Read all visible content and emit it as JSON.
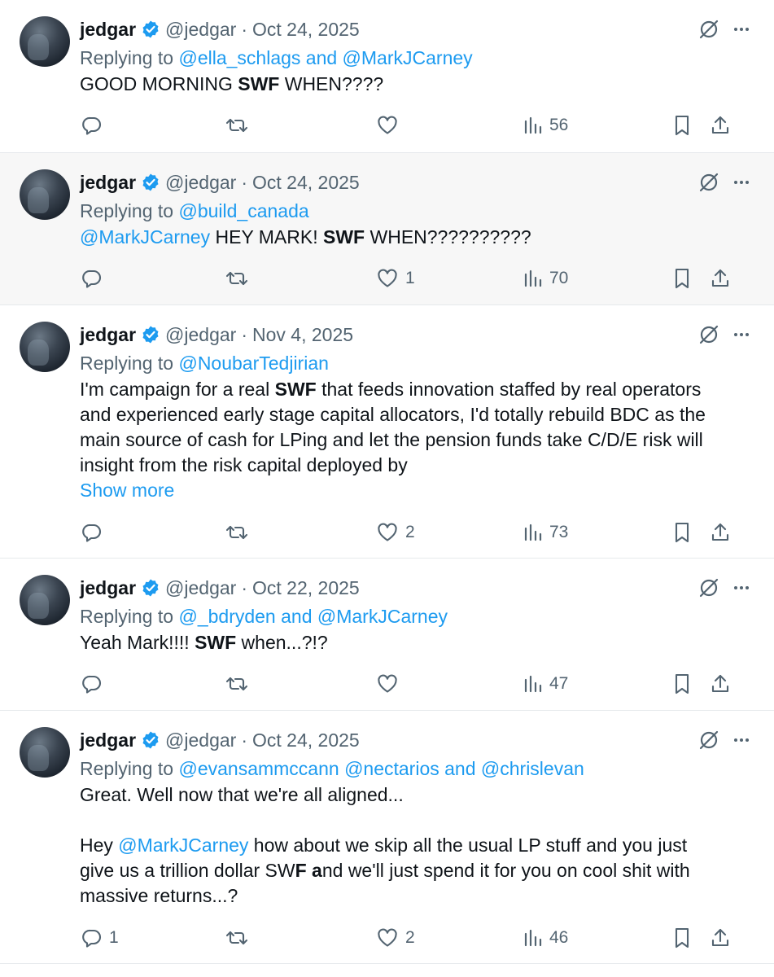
{
  "tweets": [
    {
      "name": "jedgar",
      "handle": "@jedgar",
      "dot": "·",
      "date": "Oct 24, 2025",
      "replying_prefix": "Replying to ",
      "replying_to": "@ella_schlags and @MarkJCarney",
      "body": [
        {
          "parts": [
            {
              "t": "GOOD MORNING "
            },
            {
              "t": "SWF",
              "b": true
            },
            {
              "t": " WHEN????"
            }
          ]
        }
      ],
      "show_more": "",
      "replies": "",
      "reposts": "",
      "likes": "",
      "views": "56",
      "highlight": false
    },
    {
      "name": "jedgar",
      "handle": "@jedgar",
      "dot": "·",
      "date": "Oct 24, 2025",
      "replying_prefix": "Replying to ",
      "replying_to": "@build_canada",
      "body": [
        {
          "parts": [
            {
              "t": "@MarkJCarney",
              "m": true
            },
            {
              "t": " HEY MARK! "
            },
            {
              "t": "SWF",
              "b": true
            },
            {
              "t": " WHEN??????????"
            }
          ]
        }
      ],
      "show_more": "",
      "replies": "",
      "reposts": "",
      "likes": "1",
      "views": "70",
      "highlight": true
    },
    {
      "name": "jedgar",
      "handle": "@jedgar",
      "dot": "·",
      "date": "Nov 4, 2025",
      "replying_prefix": "Replying to ",
      "replying_to": "@NoubarTedjirian",
      "body": [
        {
          "parts": [
            {
              "t": "I'm campaign for a real "
            },
            {
              "t": "SWF",
              "b": true
            },
            {
              "t": " that feeds innovation staffed by real operators"
            }
          ]
        },
        {
          "parts": [
            {
              "t": "and experienced early stage capital allocators, I'd totally rebuild BDC as the"
            }
          ]
        },
        {
          "parts": [
            {
              "t": "main source of cash for LPing and let the pension funds take C/D/E risk will"
            }
          ]
        },
        {
          "parts": [
            {
              "t": "insight from the risk capital deployed by"
            }
          ]
        }
      ],
      "show_more": "Show more",
      "replies": "",
      "reposts": "",
      "likes": "2",
      "views": "73",
      "highlight": false
    },
    {
      "name": "jedgar",
      "handle": "@jedgar",
      "dot": "·",
      "date": "Oct 22, 2025",
      "replying_prefix": "Replying to ",
      "replying_to": "@_bdryden and @MarkJCarney",
      "body": [
        {
          "parts": [
            {
              "t": "Yeah Mark!!!! "
            },
            {
              "t": "SWF",
              "b": true
            },
            {
              "t": " when...?!?"
            }
          ]
        }
      ],
      "show_more": "",
      "replies": "",
      "reposts": "",
      "likes": "",
      "views": "47",
      "highlight": false
    },
    {
      "name": "jedgar",
      "handle": "@jedgar",
      "dot": "·",
      "date": "Oct 24, 2025",
      "replying_prefix": "Replying to ",
      "replying_to": "@evansammccann @nectarios and @chrislevan",
      "body": [
        {
          "parts": [
            {
              "t": "Great. Well now that we're all aligned..."
            }
          ]
        },
        {
          "gap": true
        },
        {
          "parts": [
            {
              "t": "Hey "
            },
            {
              "t": "@MarkJCarney",
              "m": true
            },
            {
              "t": " how about we skip all the usual LP stuff and you just"
            }
          ]
        },
        {
          "parts": [
            {
              "t": "give us a trillion dollar SW"
            },
            {
              "t": "F a",
              "b": true
            },
            {
              "t": "nd we'll just spend it for you on cool shit with"
            }
          ]
        },
        {
          "parts": [
            {
              "t": "massive returns...?"
            }
          ]
        }
      ],
      "show_more": "",
      "replies": "1",
      "reposts": "",
      "likes": "2",
      "views": "46",
      "highlight": false
    }
  ],
  "icons": {
    "verified": "verified-badge-icon",
    "grok": "grok-icon",
    "more": "more-icon",
    "reply": "reply-icon",
    "repost": "repost-icon",
    "like": "like-icon",
    "views": "views-icon",
    "bookmark": "bookmark-icon",
    "share": "share-icon"
  },
  "colors": {
    "accent": "#1d9bf0",
    "muted": "#536471",
    "text": "#0f1419",
    "highlight_bg": "#f7f7f7"
  }
}
